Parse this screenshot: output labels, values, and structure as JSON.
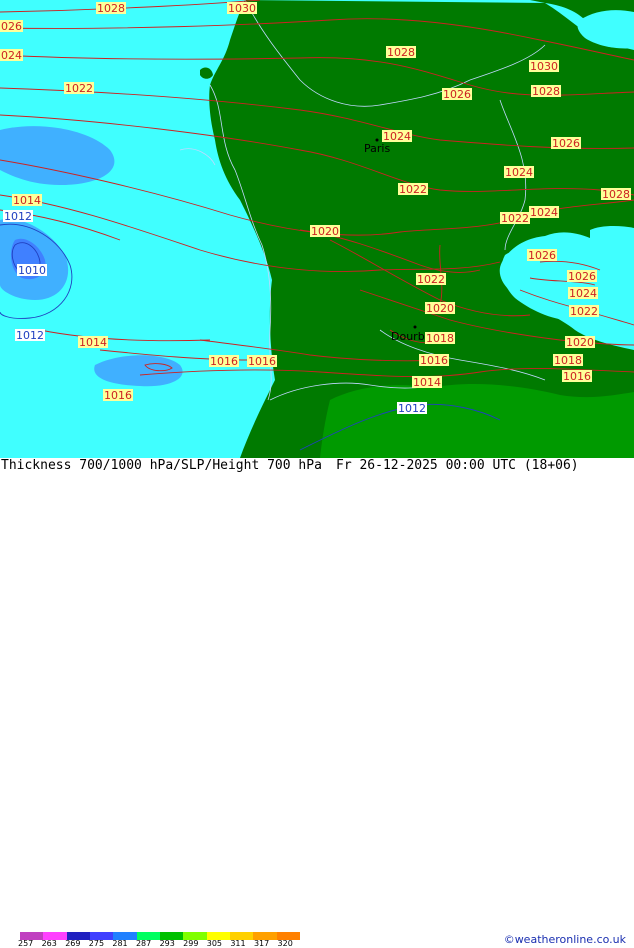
{
  "header": {
    "title": "Thickness 700/1000 hPa/SLP/Height 700 hPa",
    "valid_time": "Fr 26-12-2025 00:00 UTC (18+06)",
    "credit": "©weatheronline.co.uk"
  },
  "legend": {
    "ticks": [
      "257",
      "263",
      "269",
      "275",
      "281",
      "287",
      "293",
      "299",
      "305",
      "311",
      "317",
      "320"
    ],
    "colors": [
      "#c040c0",
      "#ff40ff",
      "#2020c0",
      "#4040ff",
      "#2080ff",
      "#00ff60",
      "#00c000",
      "#80ff00",
      "#ffff00",
      "#ffd000",
      "#ffa000",
      "#ff8000"
    ]
  },
  "map": {
    "colors": {
      "sea_cyan": "#40ffff",
      "low_blue": "#40b0ff",
      "lower_blue": "#4080ff",
      "land_dark_green": "#007a00",
      "land_green": "#009a00",
      "isobar": "#cc2222",
      "isobar_blue": "#2040c0",
      "label_box": "#ffff99"
    },
    "cities": [
      {
        "name": "Paris"
      },
      {
        "name": "Dourbies"
      }
    ],
    "isobar_labels": [
      {
        "text": "1028"
      },
      {
        "text": "1030"
      },
      {
        "text": "026"
      },
      {
        "text": "024"
      },
      {
        "text": "1022"
      },
      {
        "text": "1028"
      },
      {
        "text": "1030"
      },
      {
        "text": "1026"
      },
      {
        "text": "1028"
      },
      {
        "text": "1024"
      },
      {
        "text": "1026"
      },
      {
        "text": "1028"
      },
      {
        "text": "1014"
      },
      {
        "text": "1012"
      },
      {
        "text": "1022"
      },
      {
        "text": "1024"
      },
      {
        "text": "1022"
      },
      {
        "text": "1024"
      },
      {
        "text": "1020"
      },
      {
        "text": "1010"
      },
      {
        "text": "1026"
      },
      {
        "text": "1022"
      },
      {
        "text": "1026"
      },
      {
        "text": "1024"
      },
      {
        "text": "1020"
      },
      {
        "text": "1022"
      },
      {
        "text": "1012"
      },
      {
        "text": "1014"
      },
      {
        "text": "1018"
      },
      {
        "text": "1020"
      },
      {
        "text": "1016"
      },
      {
        "text": "1016"
      },
      {
        "text": "1016"
      },
      {
        "text": "1018"
      },
      {
        "text": "1016"
      },
      {
        "text": "1016"
      },
      {
        "text": "1014"
      },
      {
        "text": "1012"
      }
    ]
  }
}
